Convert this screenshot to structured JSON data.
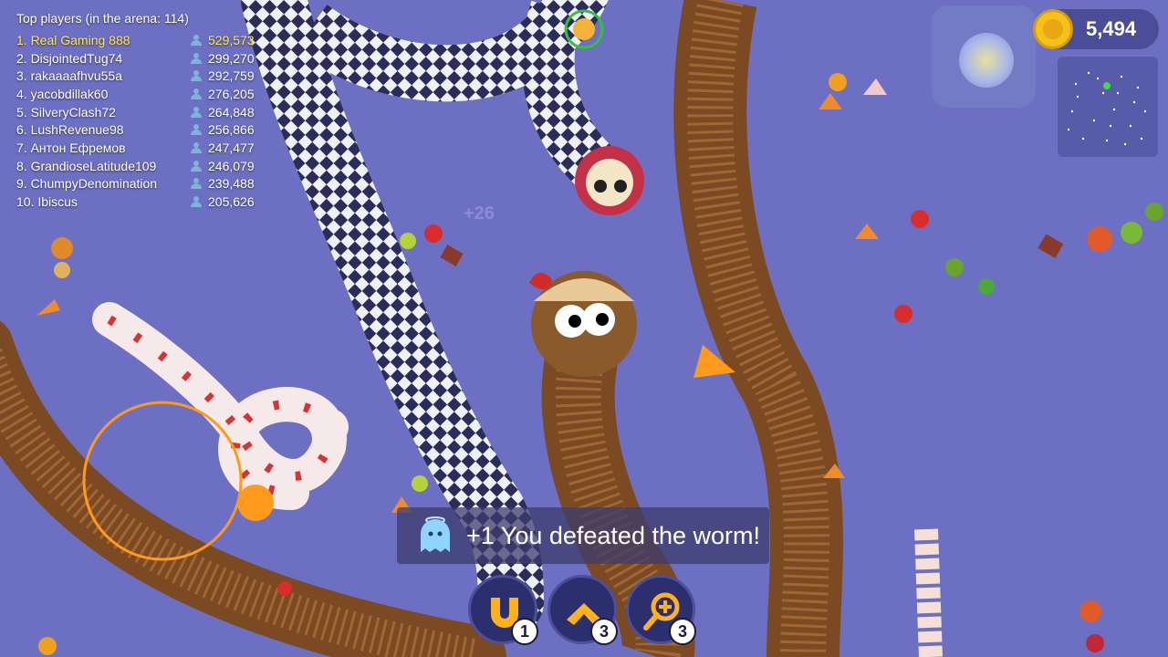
{
  "leaderboard": {
    "title": "Top players (in the arena: 114)",
    "players": [
      {
        "rank_name": "1. Real Gaming 888",
        "score": "529,573"
      },
      {
        "rank_name": "2. DisjointedTug74",
        "score": "299,270"
      },
      {
        "rank_name": "3. rakaaaafhvu55a",
        "score": "292,759"
      },
      {
        "rank_name": "4. yacobdillak60",
        "score": "276,205"
      },
      {
        "rank_name": "5. SilveryClash72",
        "score": "264,848"
      },
      {
        "rank_name": "6. LushRevenue98",
        "score": "256,866"
      },
      {
        "rank_name": "7. Антон Ефремов",
        "score": "247,477"
      },
      {
        "rank_name": "8. GrandioseLatitude109",
        "score": "246,079"
      },
      {
        "rank_name": "9. ChumpyDenomination",
        "score": "239,488"
      },
      {
        "rank_name": "10. Ibiscus",
        "score": "205,626"
      }
    ]
  },
  "coins": {
    "value": "5,494",
    "icon": "coin-icon"
  },
  "toast": {
    "text": "+1 You defeated the worm!",
    "icon": "ghost-icon"
  },
  "powerups": [
    {
      "icon": "magnet-icon",
      "count": "1"
    },
    {
      "icon": "speed-chevron-icon",
      "count": "3"
    },
    {
      "icon": "zoom-magnifier-icon",
      "count": "3"
    }
  ],
  "floating_score": "+26",
  "colors": {
    "arena": "#6d6fc2",
    "accent": "#ff9a1c",
    "gold": "#f5c21b"
  }
}
